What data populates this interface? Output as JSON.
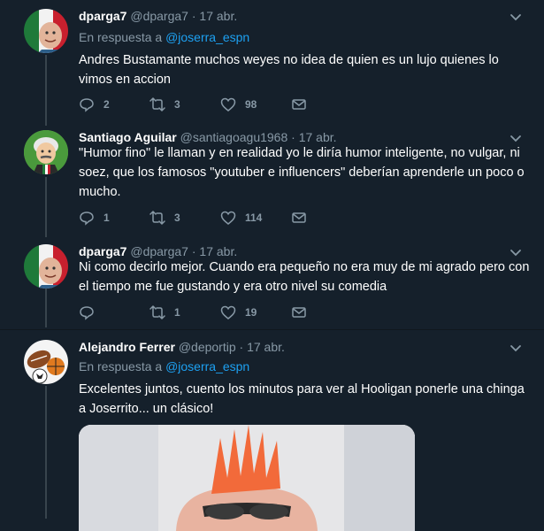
{
  "tweets": [
    {
      "name": "dparga7",
      "handle": "@dparga7",
      "sep": "·",
      "date": "17 abr.",
      "reply_prefix": "En respuesta a",
      "reply_handle": "@joserra_espn",
      "text": "Andres Bustamante muchos weyes no idea de quien es un lujo quienes lo vimos en accion",
      "replies": "2",
      "retweets": "3",
      "likes": "98"
    },
    {
      "name": "Santiago Aguilar",
      "handle": "@santiagoagu1968",
      "sep": "·",
      "date": "17 abr.",
      "text": "\"Humor fino\" le llaman y en realidad yo le diría humor inteligente, no vulgar, ni soez, que los famosos \"youtuber e influencers\" deberían aprenderle un poco o mucho.",
      "replies": "1",
      "retweets": "3",
      "likes": "114"
    },
    {
      "name": "dparga7",
      "handle": "@dparga7",
      "sep": "·",
      "date": "17 abr.",
      "text": "Ni como decirlo mejor. Cuando era pequeño no era muy de mi agrado pero con el tiempo me fue gustando y era otro nivel su comedia",
      "replies": "",
      "retweets": "1",
      "likes": "19"
    },
    {
      "name": "Alejandro Ferrer",
      "handle": "@deportip",
      "sep": "·",
      "date": "17 abr.",
      "reply_prefix": "En respuesta a",
      "reply_handle": "@joserra_espn",
      "text": "Excelentes juntos, cuento los minutos para ver al Hooligan ponerle una chinga a Joserrito... un clásico!"
    }
  ],
  "colors": {
    "background": "#15202b",
    "secondary_text": "#8899a6",
    "link": "#1da1f2",
    "thread_line": "#38444d"
  },
  "icons": [
    "chevron-down-icon",
    "reply-icon",
    "retweet-icon",
    "like-icon",
    "message-icon"
  ]
}
